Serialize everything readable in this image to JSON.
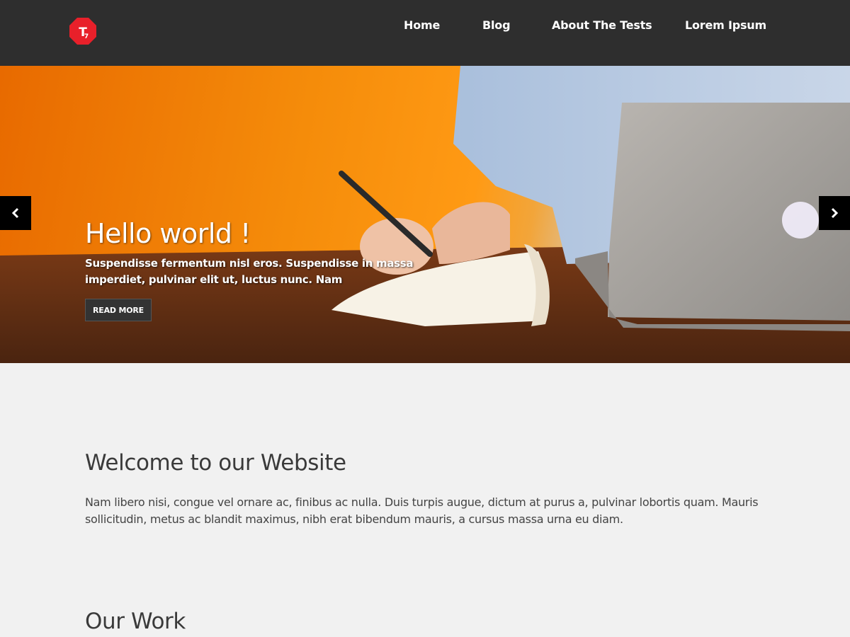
{
  "header": {
    "logo": {
      "icon": "brand-logo-icon",
      "color": "#e8202a"
    },
    "nav": [
      {
        "label": "Home"
      },
      {
        "label": "Blog"
      },
      {
        "label": "About The Tests"
      },
      {
        "label": "Lorem Ipsum"
      }
    ]
  },
  "hero": {
    "title": "Hello world !",
    "text": "Suspendisse fermentum nisl eros. Suspendisse in massa imperdiet, pulvinar elit ut, luctus nunc. Nam",
    "button_label": "READ MORE",
    "prev_icon": "chevron-left-icon",
    "next_icon": "chevron-right-icon",
    "accent_color": "#f58c0a"
  },
  "welcome": {
    "title": "Welcome to our Website",
    "text": "Nam libero nisi, congue vel ornare ac, finibus ac nulla. Duis turpis augue, dictum at purus a, pulvinar lobortis quam. Mauris sollicitudin, metus ac blandit maximus, nibh erat bibendum mauris, a cursus massa urna eu diam."
  },
  "work": {
    "title": "Our Work"
  }
}
